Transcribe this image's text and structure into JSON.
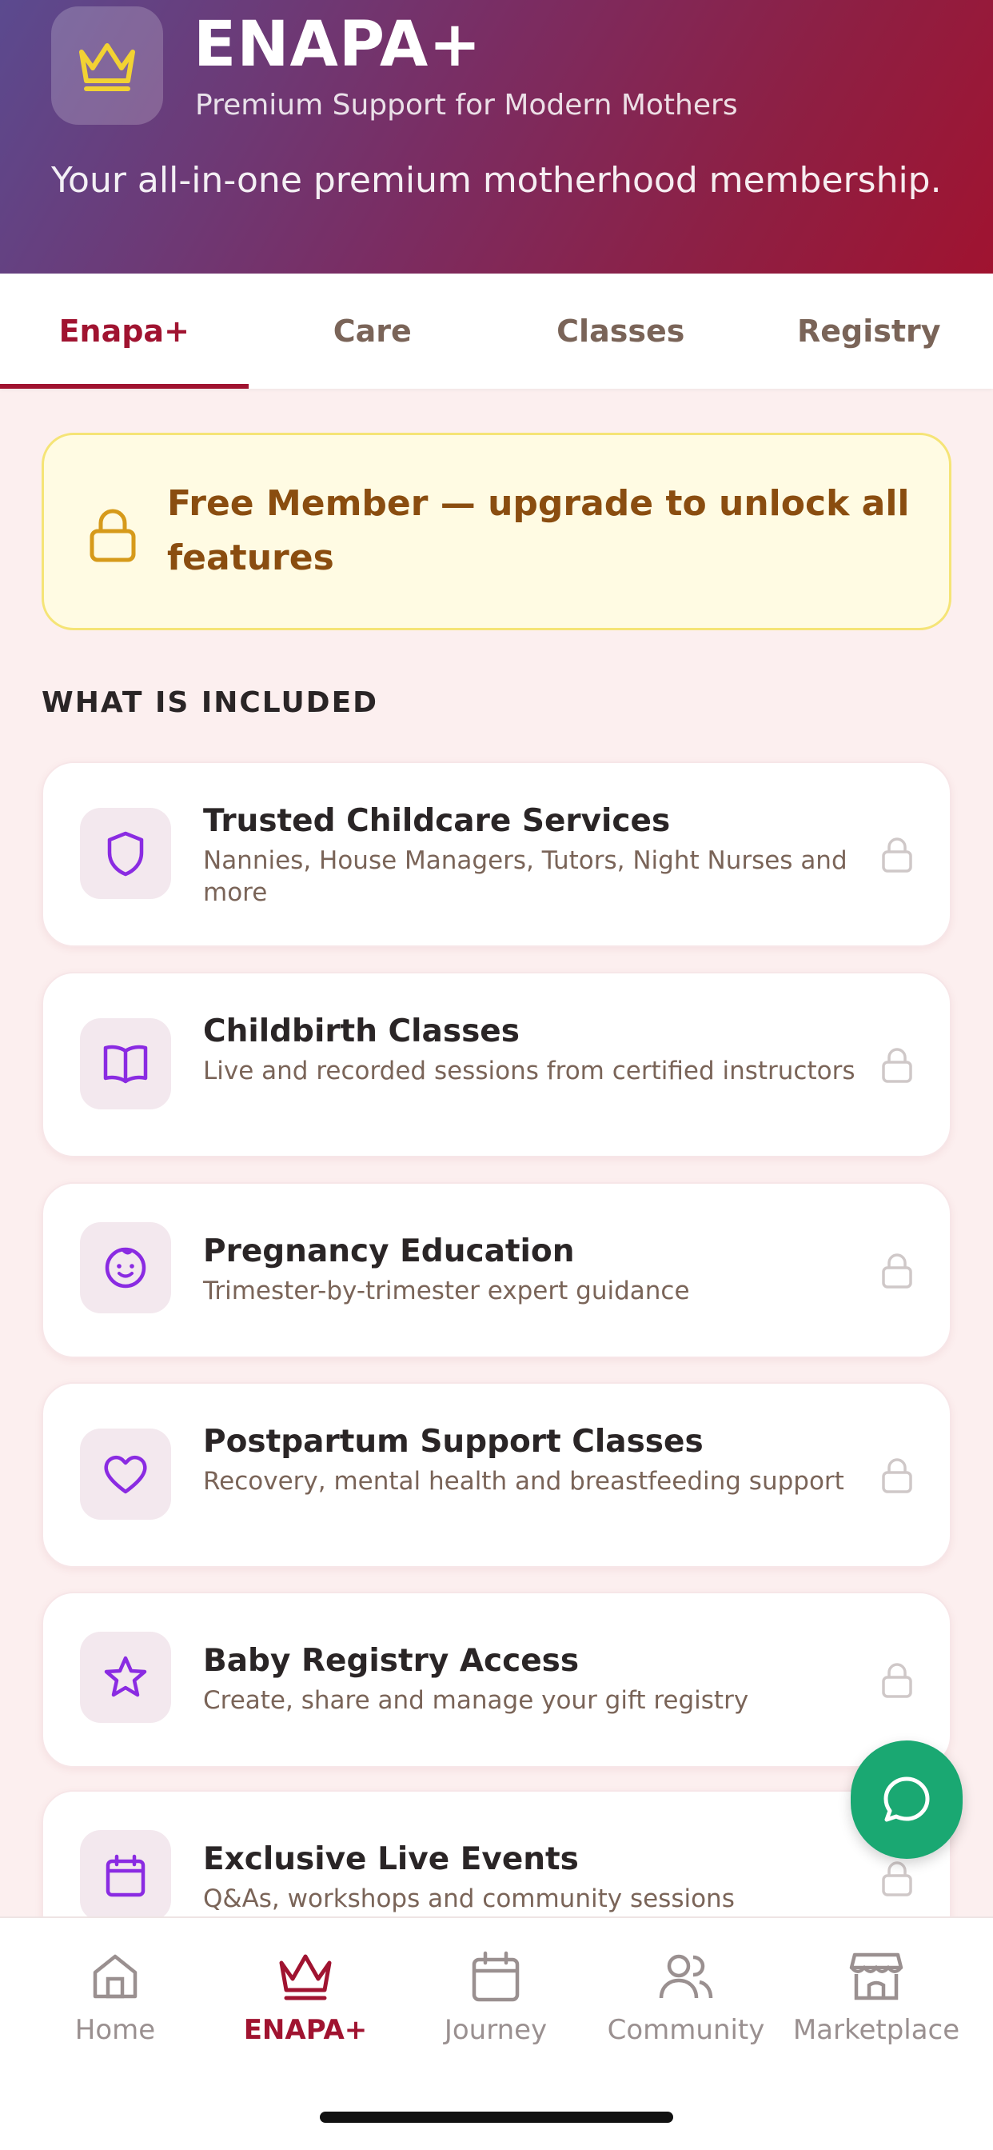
{
  "header": {
    "brand": "ENAPA+",
    "subtitle": "Premium Support for Modern Mothers",
    "tagline": "Your all-in-one premium motherhood membership.",
    "logo_icon": "crown-icon"
  },
  "tabs": [
    {
      "label": "Enapa+",
      "active": true
    },
    {
      "label": "Care",
      "active": false
    },
    {
      "label": "Classes",
      "active": false
    },
    {
      "label": "Registry",
      "active": false
    }
  ],
  "banner": {
    "text": "Free Member — upgrade to unlock all features",
    "icon": "lock-icon"
  },
  "section": {
    "label": "WHAT IS INCLUDED"
  },
  "features": [
    {
      "title": "Trusted Childcare Services",
      "desc": "Nannies, House Managers, Tutors, Night Nurses and more",
      "icon": "shield-icon"
    },
    {
      "title": "Childbirth Classes",
      "desc": "Live and recorded sessions from certified instructors",
      "icon": "book-icon"
    },
    {
      "title": "Pregnancy Education",
      "desc": "Trimester-by-trimester expert guidance",
      "icon": "baby-icon"
    },
    {
      "title": "Postpartum Support Classes",
      "desc": "Recovery, mental health and breastfeeding support",
      "icon": "heart-icon"
    },
    {
      "title": "Baby Registry Access",
      "desc": "Create, share and manage your gift registry",
      "icon": "star-icon"
    },
    {
      "title": "Exclusive Live Events",
      "desc": "Q&As, workshops and community sessions",
      "icon": "calendar-icon"
    }
  ],
  "fab": {
    "icon": "chat-icon"
  },
  "nav": [
    {
      "label": "Home",
      "icon": "home-icon",
      "active": false
    },
    {
      "label": "ENAPA+",
      "icon": "crown-icon",
      "active": true
    },
    {
      "label": "Journey",
      "icon": "calendar-icon",
      "active": false
    },
    {
      "label": "Community",
      "icon": "people-icon",
      "active": false
    },
    {
      "label": "Marketplace",
      "icon": "store-icon",
      "active": false
    }
  ],
  "colors": {
    "accent": "#a01330",
    "banner_text": "#8a4d10",
    "icon_purple": "#8a2be2",
    "fab": "#1aa872"
  }
}
